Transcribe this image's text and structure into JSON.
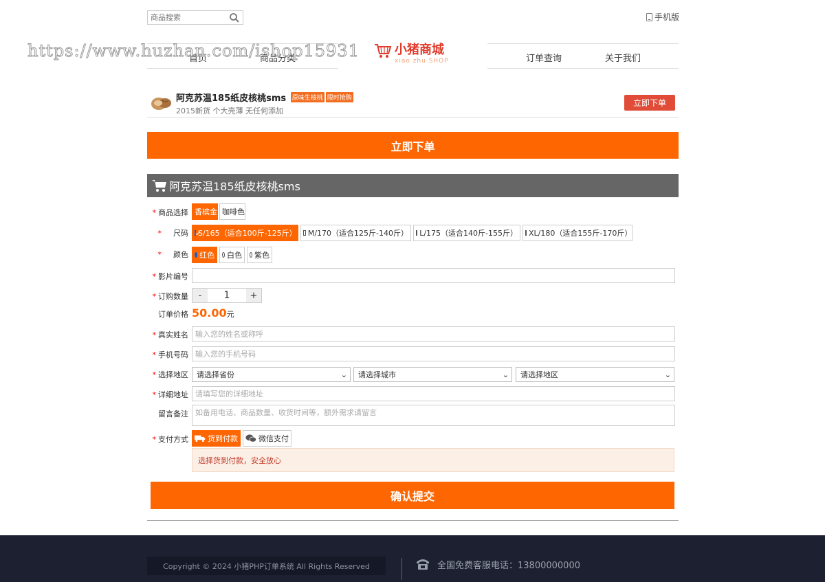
{
  "header": {
    "search_placeholder": "商品搜索",
    "mobile_label": "手机版"
  },
  "nav": {
    "items": [
      "首页",
      "商品分类",
      "订单查询",
      "关于我们"
    ],
    "watermark": "https://www.huzhan.com/ishop15931",
    "logo_text": "小猪商城",
    "logo_sub": "xiao zhu SHOP"
  },
  "product": {
    "title": "阿克苏温185纸皮核桃sms",
    "tags": [
      "原味生核桃",
      "限时抢购"
    ],
    "subtitle": "2015新货 个大壳薄 无任何添加",
    "order_button": "立即下单"
  },
  "order_now_bar": "立即下单",
  "form": {
    "header_title": "阿克苏温185纸皮核桃sms",
    "labels": {
      "goods": "商品选择",
      "size": "尺码",
      "color": "颜色",
      "film": "影片编号",
      "qty": "订购数量",
      "price": "订单价格",
      "name": "真实姓名",
      "phone": "手机号码",
      "region": "选择地区",
      "address": "详细地址",
      "remark": "留言备注",
      "pay": "支付方式"
    },
    "goods_options": [
      "香槟金",
      "咖啡色"
    ],
    "size_options": [
      "S/165（适合100斤-125斤）",
      "M/170（适合125斤-140斤）",
      "L/175（适合140斤-155斤）",
      "XL/180（适合155斤-170斤）"
    ],
    "color_options": [
      "红色",
      "白色",
      "紫色"
    ],
    "quantity": "1",
    "qty_minus": "-",
    "qty_plus": "+",
    "price_value": "50.00",
    "price_unit": "元",
    "name_placeholder": "输入您的姓名或称呼",
    "phone_placeholder": "输入您的手机号码",
    "province": "请选择省份",
    "city": "请选择城市",
    "district": "请选择地区",
    "address_placeholder": "请填写您的详细地址",
    "remark_placeholder": "如备用电话、商品数量、收货时间等，额外需求请留言",
    "pay_options": [
      "货到付款",
      "微信支付"
    ],
    "pay_notice": "选择货到付款，安全放心",
    "submit": "确认提交"
  },
  "footer": {
    "copyright": "Copyright © 2024 小猪PHP订单系统 All Rights Reserved",
    "hotline_label": "全国免费客服电话：",
    "hotline_number": "13800000000"
  },
  "colors": {
    "accent": "#fe6602",
    "red_button": "#e04c37",
    "header_gray": "#666666",
    "footer_bg": "#1c2030"
  }
}
